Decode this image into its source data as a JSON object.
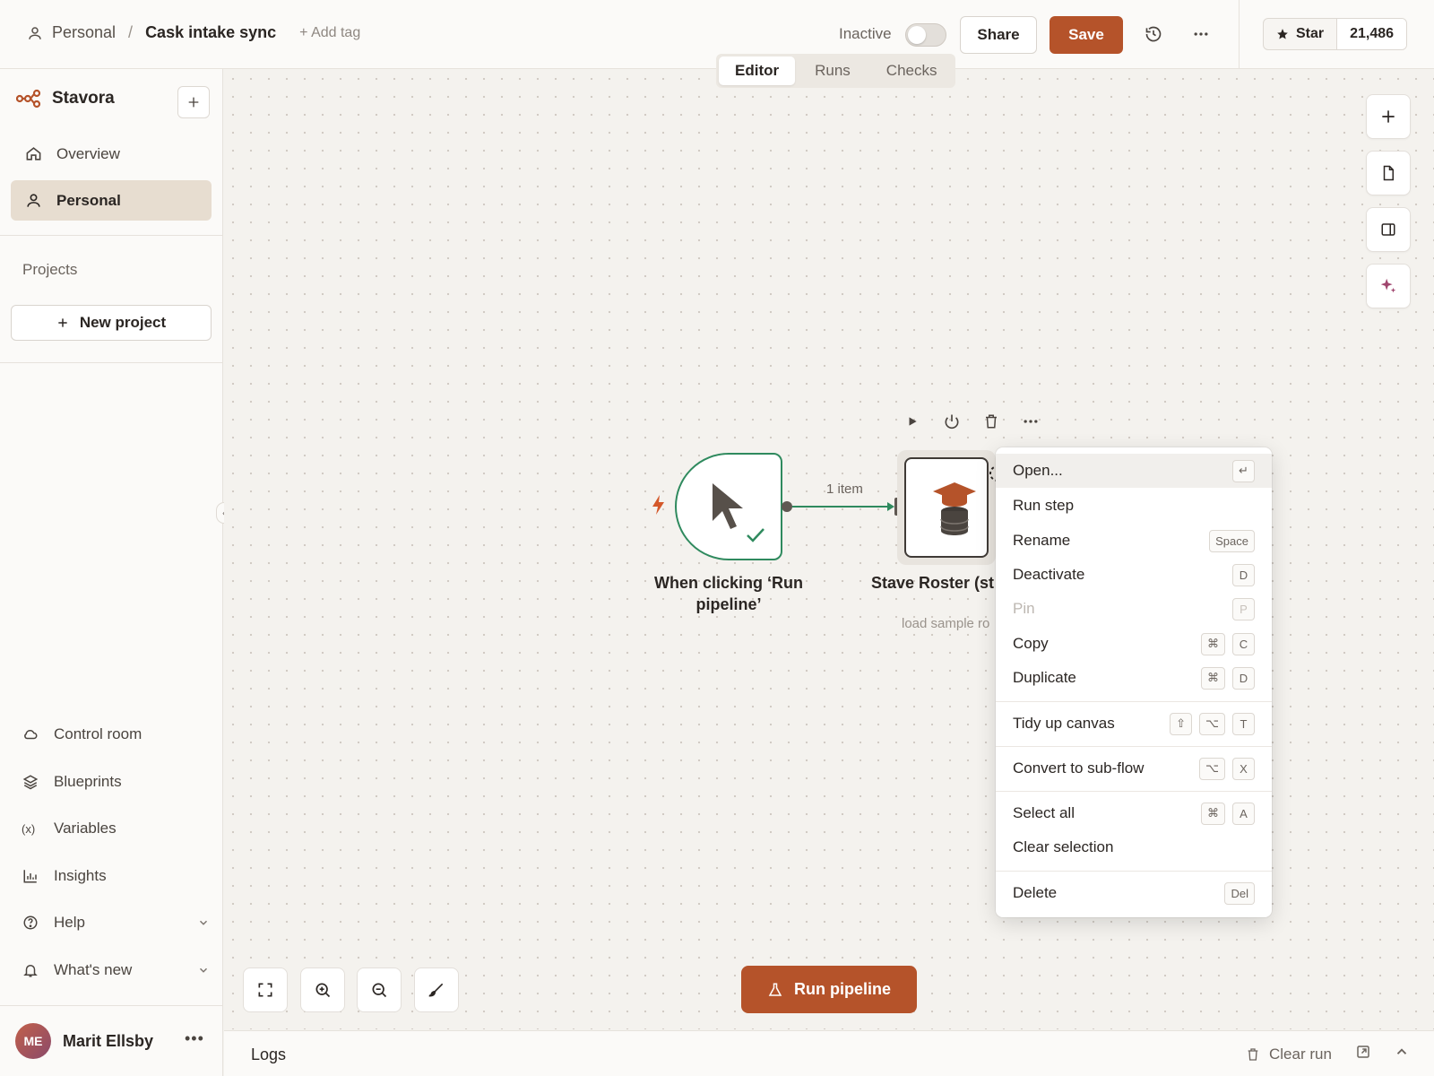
{
  "header": {
    "breadcrumb_root": "Personal",
    "breadcrumb_sep": "/",
    "workflow_title": "Cask intake sync",
    "add_tag": "+ Add tag",
    "status_label": "Inactive",
    "active": false,
    "share_label": "Share",
    "save_label": "Save",
    "star_label": "Star",
    "star_count": "21,486"
  },
  "tabs": [
    {
      "label": "Editor",
      "active": true
    },
    {
      "label": "Runs",
      "active": false
    },
    {
      "label": "Checks",
      "active": false
    }
  ],
  "sidebar": {
    "brand": "Stavora",
    "nav": [
      {
        "label": "Overview",
        "icon": "home-icon",
        "active": false
      },
      {
        "label": "Personal",
        "icon": "user-icon",
        "active": true
      }
    ],
    "projects_label": "Projects",
    "new_project_label": "New project",
    "bottom": [
      {
        "label": "Control room",
        "icon": "cloud-icon"
      },
      {
        "label": "Blueprints",
        "icon": "layers-icon"
      },
      {
        "label": "Variables",
        "icon": "variable-icon"
      },
      {
        "label": "Insights",
        "icon": "bar-chart-icon"
      },
      {
        "label": "Help",
        "icon": "help-circle-icon"
      },
      {
        "label": "What's new",
        "icon": "bell-icon"
      }
    ],
    "user": {
      "initials": "ME",
      "name": "Marit Ellsby"
    }
  },
  "canvas": {
    "trigger_node": {
      "label": "When clicking ‘Run pipeline’"
    },
    "connection_label": "1 item",
    "action_node": {
      "label": "Stave Roster (st",
      "sub": "load sample ro"
    }
  },
  "context_menu": {
    "items": [
      {
        "label": "Open...",
        "keys": [
          "↵"
        ],
        "hover": true
      },
      {
        "label": "Run step",
        "keys": []
      },
      {
        "label": "Rename",
        "keys": [
          "Space"
        ]
      },
      {
        "label": "Deactivate",
        "keys": [
          "D"
        ]
      },
      {
        "label": "Pin",
        "keys": [
          "P"
        ],
        "disabled": true
      },
      {
        "label": "Copy",
        "keys": [
          "⌘",
          "C"
        ]
      },
      {
        "label": "Duplicate",
        "keys": [
          "⌘",
          "D"
        ]
      },
      {
        "label": "Tidy up canvas",
        "keys": [
          "⇧",
          "⌥",
          "T"
        ]
      },
      {
        "label": "Convert to sub-flow",
        "keys": [
          "⌥",
          "X"
        ]
      },
      {
        "label": "Select all",
        "keys": [
          "⌘",
          "A"
        ]
      },
      {
        "label": "Clear selection",
        "keys": []
      },
      {
        "label": "Delete",
        "keys": [
          "Del"
        ]
      }
    ]
  },
  "run_button_label": "Run pipeline",
  "logs": {
    "label": "Logs",
    "clear_run": "Clear run"
  },
  "colors": {
    "accent": "#b5532a",
    "success": "#2f8a5e",
    "nav_active_bg": "#e7ddd0"
  }
}
